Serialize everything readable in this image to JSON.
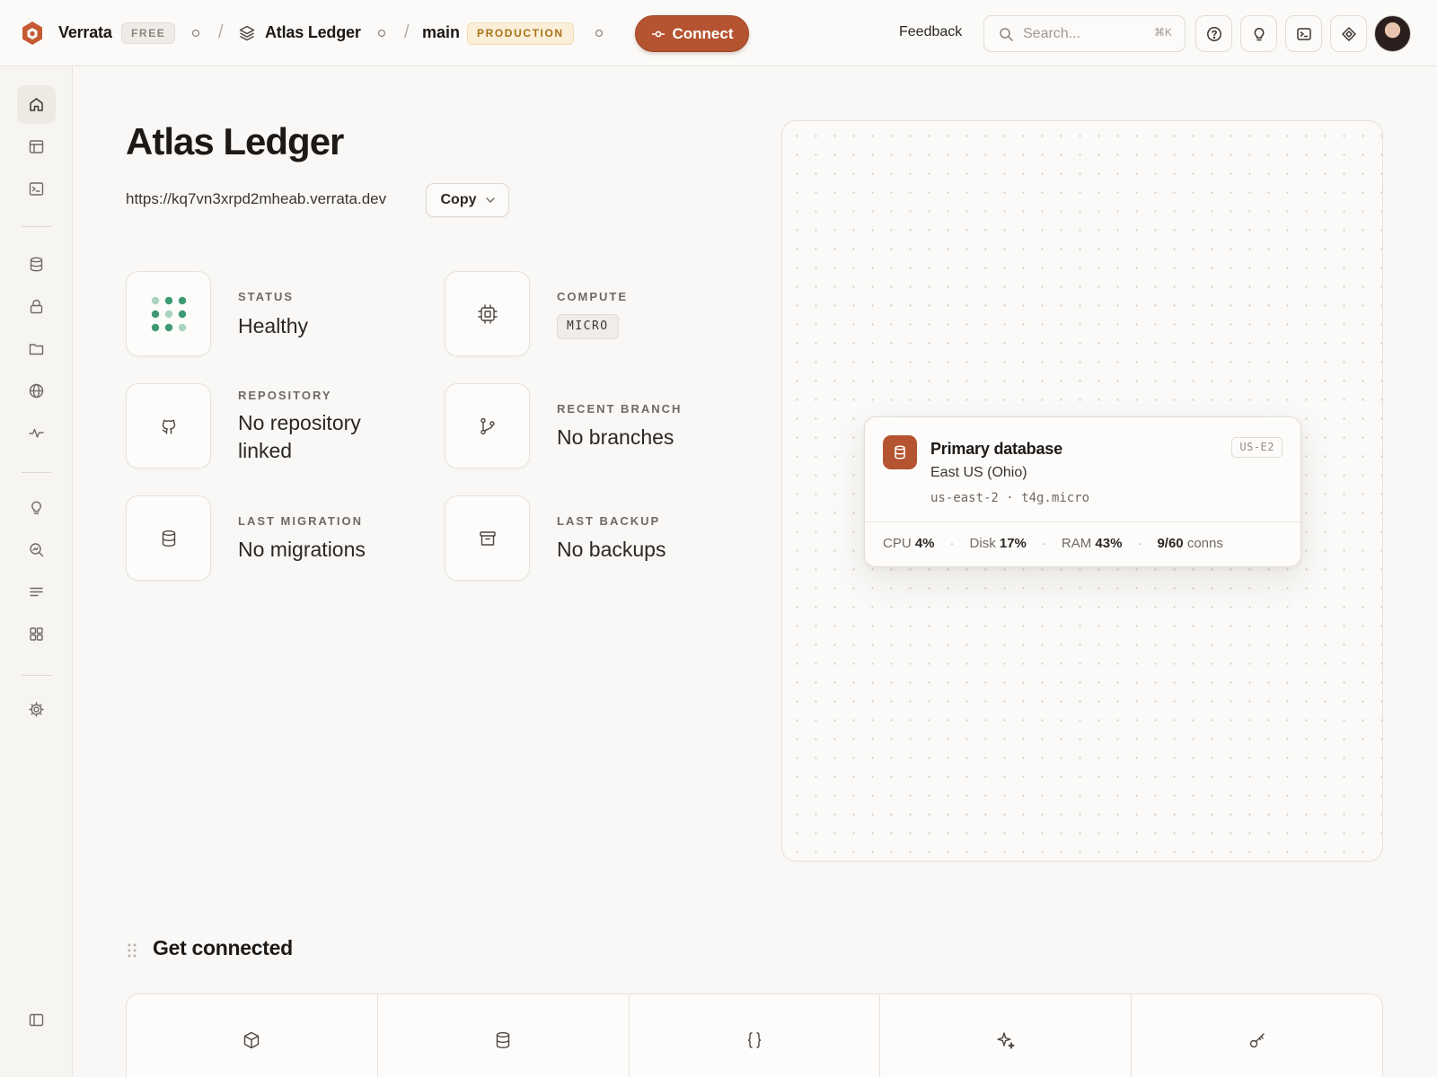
{
  "topbar": {
    "org_name": "Verrata",
    "org_plan": "FREE",
    "project_name": "Atlas Ledger",
    "branch_name": "main",
    "branch_env": "PRODUCTION",
    "connect_label": "Connect",
    "feedback_label": "Feedback",
    "search_placeholder": "Search...",
    "search_shortcut": "⌘K"
  },
  "icons": {
    "logo": "verrata-logo-icon",
    "project": "layers-icon",
    "connect": "plug-icon",
    "help": "help-circle-icon",
    "tips": "lightbulb-icon",
    "terminal": "terminal-icon",
    "assistant": "diamond-icon"
  },
  "sidebar": {
    "items": [
      {
        "name": "home",
        "icon": "home-icon",
        "active": true
      },
      {
        "name": "table-editor",
        "icon": "table-icon"
      },
      {
        "name": "sql-editor",
        "icon": "terminal-icon"
      },
      {
        "name": "database",
        "icon": "database-icon"
      },
      {
        "name": "auth",
        "icon": "lock-icon"
      },
      {
        "name": "storage",
        "icon": "folder-icon"
      },
      {
        "name": "edge",
        "icon": "globe-icon"
      },
      {
        "name": "realtime",
        "icon": "activity-icon"
      },
      {
        "name": "advisors",
        "icon": "lightbulb-icon"
      },
      {
        "name": "observability",
        "icon": "search-chart-icon"
      },
      {
        "name": "logs",
        "icon": "list-icon"
      },
      {
        "name": "integrations",
        "icon": "grid-icon"
      },
      {
        "name": "settings",
        "icon": "gear-icon"
      },
      {
        "name": "collapse",
        "icon": "sidebar-toggle-icon"
      }
    ]
  },
  "project": {
    "title": "Atlas Ledger",
    "url": "https://kq7vn3xrpd2mheab.verrata.dev",
    "copy_label": "Copy"
  },
  "stats": {
    "status": {
      "label": "STATUS",
      "value": "Healthy"
    },
    "compute": {
      "label": "COMPUTE",
      "value": "MICRO"
    },
    "repository": {
      "label": "REPOSITORY",
      "value": "No repository linked"
    },
    "recent_branch": {
      "label": "RECENT BRANCH",
      "value": "No branches"
    },
    "last_migration": {
      "label": "LAST MIGRATION",
      "value": "No migrations"
    },
    "last_backup": {
      "label": "LAST BACKUP",
      "value": "No backups"
    }
  },
  "database_card": {
    "title": "Primary database",
    "region": "East US (Ohio)",
    "meta": "us-east-2 · t4g.micro",
    "badge": "US-E2",
    "cpu_label": "CPU",
    "cpu_value": "4%",
    "disk_label": "Disk",
    "disk_value": "17%",
    "ram_label": "RAM",
    "ram_value": "43%",
    "conns_value": "9/60",
    "conns_label": "conns",
    "accent_color": "#b55431"
  },
  "get_connected": {
    "title": "Get connected",
    "options": [
      {
        "icon": "package-icon"
      },
      {
        "icon": "database-icon"
      },
      {
        "icon": "braces-icon"
      },
      {
        "icon": "sparkles-icon"
      },
      {
        "icon": "key-icon"
      }
    ]
  },
  "colors": {
    "accent": "#b55431",
    "status_green": "#3d9a72",
    "production_badge": "#a87419"
  }
}
